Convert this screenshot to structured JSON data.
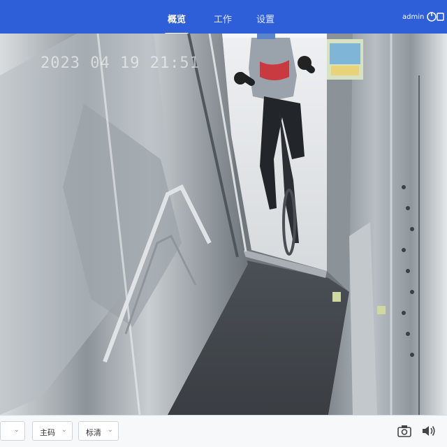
{
  "nav": {
    "tabs": [
      {
        "label": "概览",
        "active": true
      },
      {
        "label": "工作",
        "active": false
      },
      {
        "label": "设置",
        "active": false
      }
    ],
    "user": "admin"
  },
  "video": {
    "osd_text": "2023 04 19 21:51"
  },
  "controls": {
    "channel_select": "",
    "stream_select": "主码",
    "quality_select": "标清"
  },
  "colors": {
    "topbar": "#2f5fd8",
    "bottombar": "#f7f8fa"
  },
  "icons": [
    "logout-icon",
    "chevron-down-icon",
    "snapshot-icon",
    "volume-icon"
  ]
}
